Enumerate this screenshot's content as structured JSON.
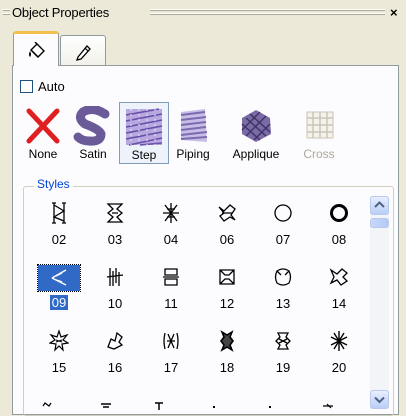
{
  "panel": {
    "title": "Object Properties",
    "close_glyph": "×"
  },
  "tabs": [
    {
      "icon": "paint-bucket-icon",
      "active": true
    },
    {
      "icon": "pencil-icon",
      "active": false
    }
  ],
  "auto": {
    "label": "Auto",
    "checked": false
  },
  "stitch_types": [
    {
      "label": "None",
      "icon": "none-x-icon"
    },
    {
      "label": "Satin",
      "icon": "satin-icon"
    },
    {
      "label": "Step",
      "icon": "step-fill-icon",
      "selected": true
    },
    {
      "label": "Piping",
      "icon": "piping-icon"
    },
    {
      "label": "Applique",
      "icon": "applique-icon"
    },
    {
      "label": "Cross",
      "icon": "cross-stitch-icon",
      "disabled": true
    }
  ],
  "styles": {
    "legend": "Styles",
    "items": [
      "02",
      "03",
      "04",
      "06",
      "07",
      "08",
      "09",
      "10",
      "11",
      "12",
      "13",
      "14",
      "15",
      "16",
      "17",
      "18",
      "19",
      "20"
    ],
    "selected": "09"
  },
  "colors": {
    "accent_tab": "#f3c04e",
    "selection": "#3169c6",
    "legend": "#0046d5",
    "none_x": "#e02020",
    "satin": "#6a5a98"
  }
}
